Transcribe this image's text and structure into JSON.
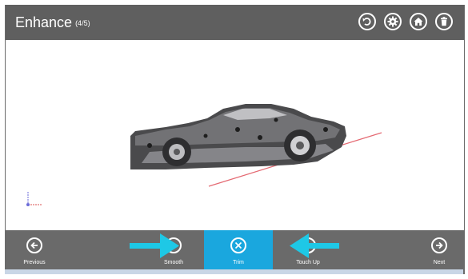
{
  "header": {
    "title": "Enhance",
    "step": "(4/5)",
    "icons": [
      "undo-icon",
      "settings-icon",
      "home-icon",
      "trash-icon"
    ]
  },
  "toolbar": {
    "previous_label": "Previous",
    "smooth_label": "Smooth",
    "trim_label": "Trim",
    "touchup_label": "Touch Up",
    "next_label": "Next",
    "active_tool": "Trim"
  },
  "colors": {
    "header_bg": "#5f5f5f",
    "toolbar_bg": "#6a6a6a",
    "active_tool_bg": "#1aa7de",
    "annotation_arrow": "#1ec8e6",
    "floor_axis": "#e0505a"
  }
}
